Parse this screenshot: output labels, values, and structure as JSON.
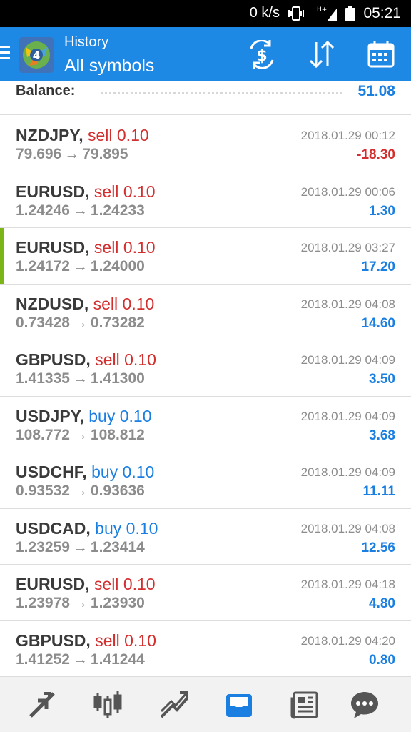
{
  "status_bar": {
    "network_speed": "0 k/s",
    "time": "05:21",
    "signal_type": "H+"
  },
  "app_bar": {
    "subtitle": "History",
    "title": "All symbols"
  },
  "balance": {
    "label": "Balance:",
    "value": "51.08"
  },
  "trades": [
    {
      "symbol": "NZDJPY,",
      "side": "sell",
      "volume": "0.10",
      "open": "79.696",
      "close": "79.895",
      "time": "2018.01.29 00:12",
      "profit": "-18.30",
      "sign": "neg",
      "selected": false
    },
    {
      "symbol": "EURUSD,",
      "side": "sell",
      "volume": "0.10",
      "open": "1.24246",
      "close": "1.24233",
      "time": "2018.01.29 00:06",
      "profit": "1.30",
      "sign": "pos",
      "selected": false
    },
    {
      "symbol": "EURUSD,",
      "side": "sell",
      "volume": "0.10",
      "open": "1.24172",
      "close": "1.24000",
      "time": "2018.01.29 03:27",
      "profit": "17.20",
      "sign": "pos",
      "selected": true
    },
    {
      "symbol": "NZDUSD,",
      "side": "sell",
      "volume": "0.10",
      "open": "0.73428",
      "close": "0.73282",
      "time": "2018.01.29 04:08",
      "profit": "14.60",
      "sign": "pos",
      "selected": false
    },
    {
      "symbol": "GBPUSD,",
      "side": "sell",
      "volume": "0.10",
      "open": "1.41335",
      "close": "1.41300",
      "time": "2018.01.29 04:09",
      "profit": "3.50",
      "sign": "pos",
      "selected": false
    },
    {
      "symbol": "USDJPY,",
      "side": "buy",
      "volume": "0.10",
      "open": "108.772",
      "close": "108.812",
      "time": "2018.01.29 04:09",
      "profit": "3.68",
      "sign": "pos",
      "selected": false
    },
    {
      "symbol": "USDCHF,",
      "side": "buy",
      "volume": "0.10",
      "open": "0.93532",
      "close": "0.93636",
      "time": "2018.01.29 04:09",
      "profit": "11.11",
      "sign": "pos",
      "selected": false
    },
    {
      "symbol": "USDCAD,",
      "side": "buy",
      "volume": "0.10",
      "open": "1.23259",
      "close": "1.23414",
      "time": "2018.01.29 04:08",
      "profit": "12.56",
      "sign": "pos",
      "selected": false
    },
    {
      "symbol": "EURUSD,",
      "side": "sell",
      "volume": "0.10",
      "open": "1.23978",
      "close": "1.23930",
      "time": "2018.01.29 04:18",
      "profit": "4.80",
      "sign": "pos",
      "selected": false
    },
    {
      "symbol": "GBPUSD,",
      "side": "sell",
      "volume": "0.10",
      "open": "1.41252",
      "close": "1.41244",
      "time": "2018.01.29 04:20",
      "profit": "0.80",
      "sign": "pos",
      "selected": false
    }
  ],
  "bottom_nav": [
    {
      "icon": "quotes-icon",
      "active": false
    },
    {
      "icon": "chart-icon",
      "active": false
    },
    {
      "icon": "trade-icon",
      "active": false
    },
    {
      "icon": "history-icon",
      "active": true
    },
    {
      "icon": "news-icon",
      "active": false
    },
    {
      "icon": "chat-icon",
      "active": false
    }
  ],
  "colors": {
    "appbar": "#1e88e5",
    "sell": "#d32f2f",
    "buy": "#1a7fe0",
    "selected_marker": "#7cb518"
  }
}
